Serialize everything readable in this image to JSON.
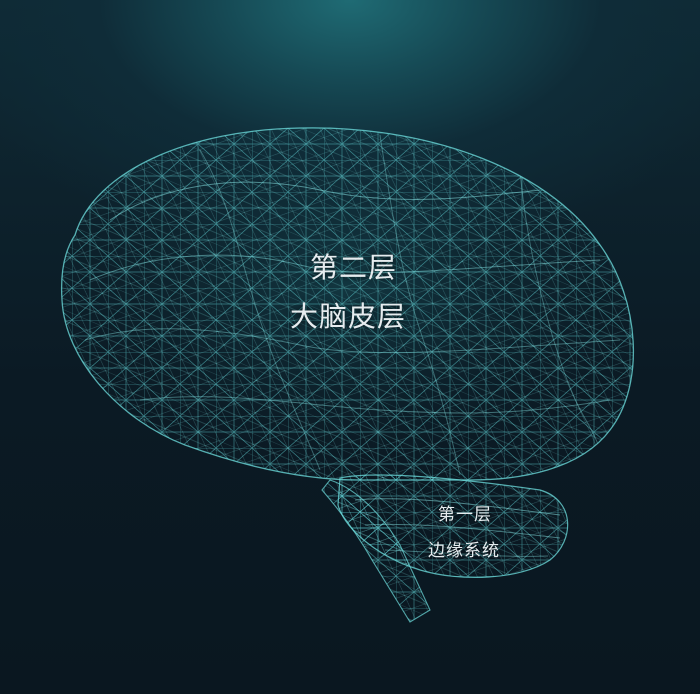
{
  "cortex_layer": {
    "level_text": "第二层",
    "name_text": "大脑皮层"
  },
  "limbic_layer": {
    "level_text": "第一层",
    "name_text": "边缘系统"
  },
  "colors": {
    "background_dark": "#0b1a24",
    "glow_top": "#1f6b74",
    "mesh_line": "#5fd3d6",
    "label_text": "#e6ecef"
  }
}
